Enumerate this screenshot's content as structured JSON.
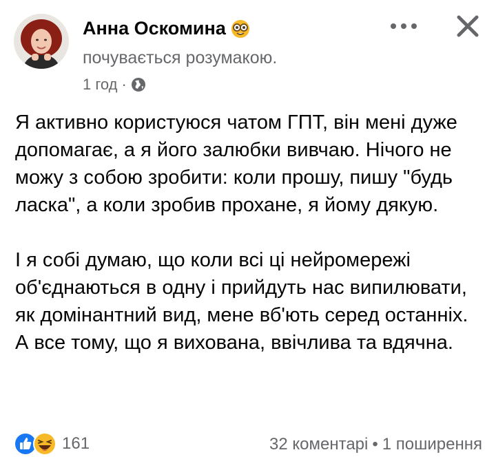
{
  "post": {
    "author": "Анна Оскомина",
    "feeling_icon": "nerd-face-emoji-icon",
    "feeling": "почувається розумакою.",
    "time": "1 год",
    "separator": "·",
    "audience_icon": "globe-icon",
    "paragraphs": [
      "Я активно користуюся чатом ГПТ, він мені дуже допомагає, а я його залюбки вивчаю. Нічого не можу з собою зробити: коли прошу, пишу \"будь ласка\", а коли зробив прохане, я йому дякую.",
      "І я собі думаю, що коли всі ці нейромережі об'єднаються в одну і прийдуть нас випилювати, як домінантний вид,  мене вб'ють серед останніх. А все тому,  що я вихована,  ввічлива та вдячна."
    ]
  },
  "header_actions": {
    "more_icon": "more-horizontal-icon",
    "close_icon": "close-icon"
  },
  "footer": {
    "reaction_icons": [
      "like-icon",
      "haha-icon"
    ],
    "reactions_count": "161",
    "comments": "32 коментарі",
    "separator": "•",
    "shares": "1 поширення"
  },
  "colors": {
    "text": "#050505",
    "secondary": "#65676b",
    "like_blue": "#1877f2",
    "haha_yellow": "#f7b928"
  }
}
